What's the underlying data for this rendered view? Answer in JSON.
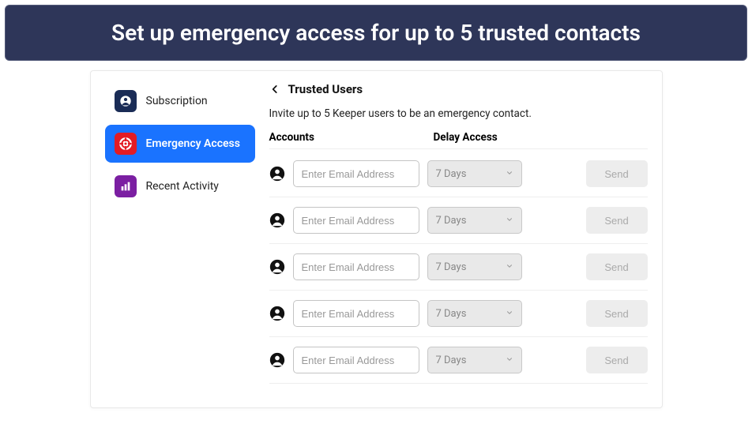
{
  "banner": "Set up emergency access for up to 5 trusted contacts",
  "sidebar": {
    "items": [
      {
        "label": "Subscription"
      },
      {
        "label": "Emergency Access"
      },
      {
        "label": "Recent Activity"
      }
    ]
  },
  "main": {
    "title": "Trusted Users",
    "subtitle": "Invite up to 5 Keeper users to be an emergency contact.",
    "col_accounts": "Accounts",
    "col_delay": "Delay Access",
    "rows": [
      {
        "placeholder": "Enter Email Address",
        "delay": "7 Days",
        "send": "Send"
      },
      {
        "placeholder": "Enter Email Address",
        "delay": "7 Days",
        "send": "Send"
      },
      {
        "placeholder": "Enter Email Address",
        "delay": "7 Days",
        "send": "Send"
      },
      {
        "placeholder": "Enter Email Address",
        "delay": "7 Days",
        "send": "Send"
      },
      {
        "placeholder": "Enter Email Address",
        "delay": "7 Days",
        "send": "Send"
      }
    ]
  }
}
